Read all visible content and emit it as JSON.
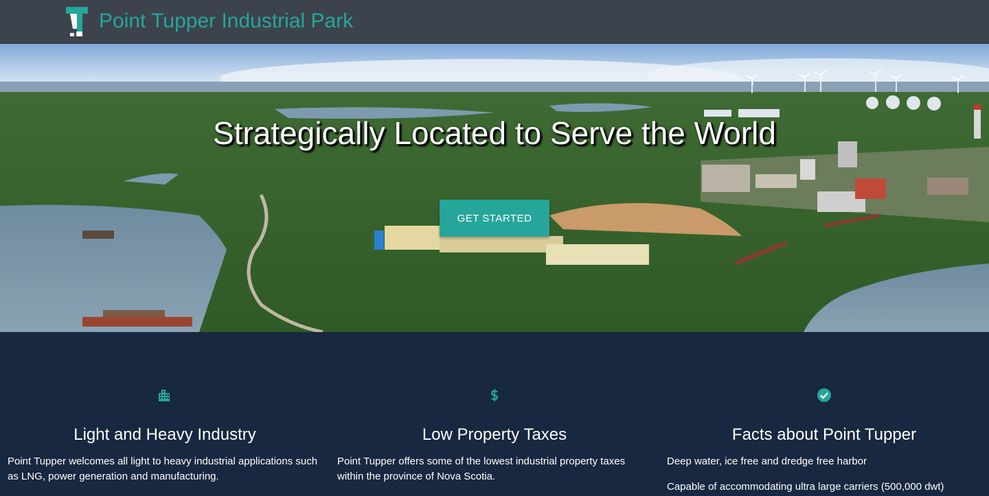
{
  "navbar": {
    "brand": "Point Tupper Industrial Park",
    "logo_icon": "tupper-t-logo-icon"
  },
  "hero": {
    "title": "Strategically Located to Serve the World",
    "cta_label": "GET STARTED",
    "background": "aerial-photo-industrial-park"
  },
  "features": [
    {
      "icon": "building-icon",
      "title": "Light and Heavy Industry",
      "lines": [
        "Point Tupper welcomes all light to heavy industrial applications such as LNG, power generation and manufacturing."
      ]
    },
    {
      "icon": "dollar-icon",
      "title": "Low Property Taxes",
      "lines": [
        "Point Tupper offers some of the lowest industrial property taxes within the province of Nova Scotia."
      ]
    },
    {
      "icon": "check-circle-icon",
      "title": "Facts about Point Tupper",
      "lines": [
        "Deep water, ice free and dredge free harbor",
        "Capable of accommodating ultra large carriers (500,000 dwt)"
      ]
    }
  ],
  "colors": {
    "accent": "#26a69a",
    "navbar": "#3c434c",
    "section_bg": "#172840"
  }
}
